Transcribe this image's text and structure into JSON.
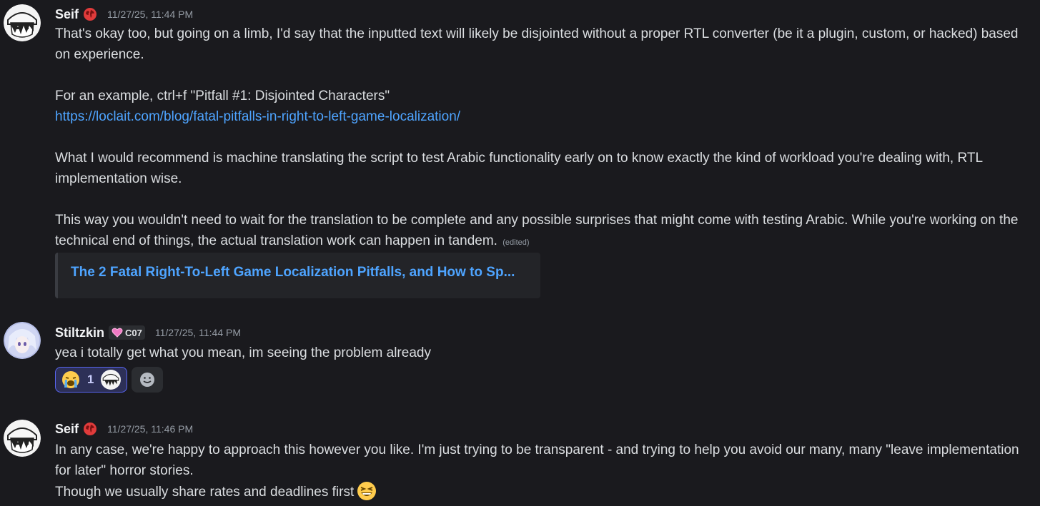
{
  "messages": [
    {
      "author": "Seif",
      "timestamp": "11/27/25, 11:44 PM",
      "role_icon": "globe-icon",
      "paragraphs": [
        "That's okay too, but going on a limb, I'd say that the inputted text will likely be disjointed without a proper RTL converter (be it a plugin, custom, or hacked) based on experience.",
        "For an example, ctrl+f \"Pitfall #1: Disjointed Characters\"",
        "https://loclait.com/blog/fatal-pitfalls-in-right-to-left-game-localization/",
        "What I would recommend is machine translating the script to test Arabic functionality early on to know exactly the kind of workload you're dealing with, RTL implementation wise.",
        "This way you wouldn't need to wait for the translation to be complete and any possible surprises that might come with testing Arabic. While you're working on the technical end of things, the actual translation work can happen in tandem."
      ],
      "edited_label": "(edited)",
      "embed_title": "The 2 Fatal Right-To-Left Game Localization Pitfalls, and How to Sp..."
    },
    {
      "author": "Stiltzkin",
      "timestamp": "11/27/25, 11:44 PM",
      "tag": {
        "icon": "heart-icon",
        "label": "C07"
      },
      "text": "yea i totally get what you mean, im seeing the problem already",
      "reaction": {
        "emoji": "loudly-crying-face",
        "count": "1"
      }
    },
    {
      "author": "Seif",
      "timestamp": "11/27/25, 11:46 PM",
      "role_icon": "globe-icon",
      "lines": [
        "In any case, we're happy to approach this however you like. I'm just trying to be transparent - and trying to help you avoid our many, many \"leave implementation for later\" horror stories.",
        "Though we usually share rates and deadlines first"
      ],
      "emoji": "laughing-face"
    }
  ],
  "colors": {
    "background": "#1a1a1e",
    "text": "#dbdee1",
    "link": "#4ea4ff",
    "muted": "#949ba4",
    "reaction_border": "#5865f2"
  }
}
